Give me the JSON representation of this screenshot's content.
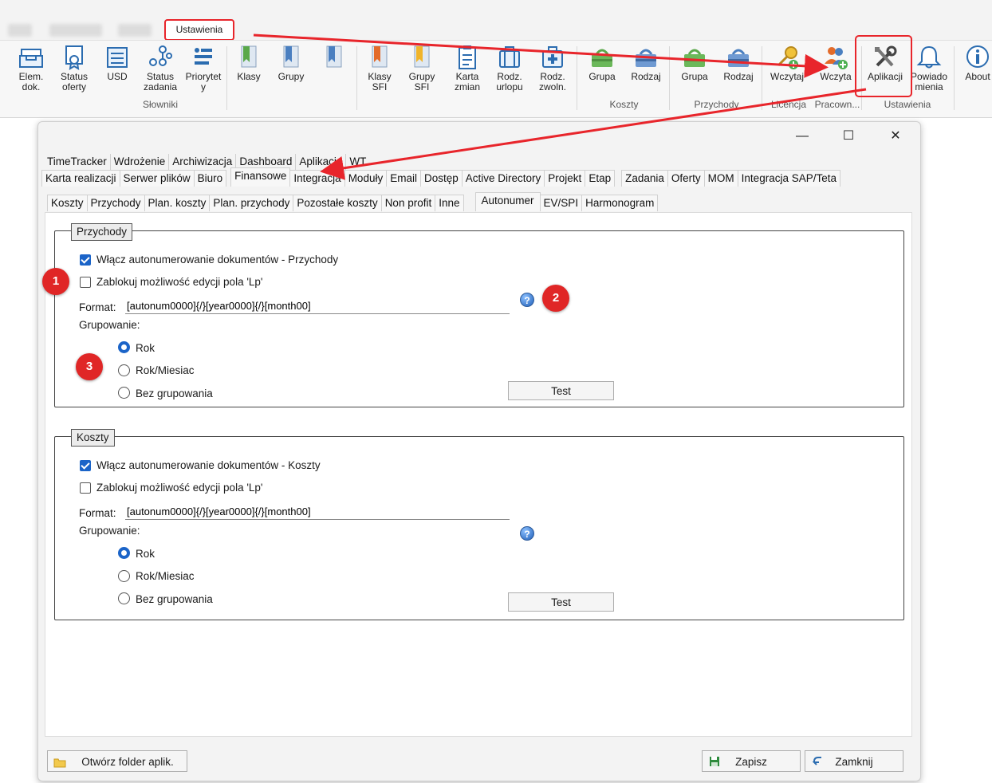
{
  "top_tabs": {
    "settings": "Ustawienia"
  },
  "ribbon": {
    "items": [
      {
        "label": "Elem.\ndok.",
        "icon": "tray-icon"
      },
      {
        "label": "Status\noferty",
        "icon": "certificate-icon"
      },
      {
        "label": "USD",
        "icon": "money-icon"
      },
      {
        "label": "Status\nzadania",
        "icon": "network-icon"
      },
      {
        "label": "Priorytet\ny",
        "icon": "priority-list-icon"
      },
      {
        "label": "Klasy",
        "icon": "bookmark-green-icon"
      },
      {
        "label": "Grupy",
        "icon": "bookmark-blue-icon"
      },
      {
        "label": "",
        "icon": "bookmark-blue-icon"
      },
      {
        "label": "Klasy\nSFI",
        "icon": "bookmark-orange-icon"
      },
      {
        "label": "Grupy\nSFI",
        "icon": "bookmark-yellow-icon"
      },
      {
        "label": "Karta\nzmian",
        "icon": "clipboard-icon"
      },
      {
        "label": "Rodz.\nurlopu",
        "icon": "suitcase-icon"
      },
      {
        "label": "Rodz.\nzwoln.",
        "icon": "medical-bag-icon"
      },
      {
        "label": "Grupa",
        "icon": "basket-green-icon"
      },
      {
        "label": "Rodzaj",
        "icon": "basket-blue-icon"
      },
      {
        "label": "Grupa",
        "icon": "basket-green-icon"
      },
      {
        "label": "Rodzaj",
        "icon": "basket-blue-icon"
      },
      {
        "label": "Wczytaj",
        "icon": "key-add-icon"
      },
      {
        "label": "Wczyta",
        "icon": "users-add-icon"
      },
      {
        "label": "Aplikacji",
        "icon": "tools-icon"
      },
      {
        "label": "Powiado\nmienia",
        "icon": "bell-icon"
      },
      {
        "label": "About",
        "icon": "info-icon"
      }
    ],
    "groups": [
      "Słowniki",
      "Koszty",
      "Przychody",
      "Licencja",
      "Pracown...",
      "Ustawienia"
    ]
  },
  "dialog": {
    "tabs_row1": [
      "TimeTracker",
      "Wdrożenie",
      "Archiwizacja",
      "Dashboard",
      "Aplikacja",
      "WT"
    ],
    "tabs_row2": [
      "Karta realizacji",
      "Serwer plików",
      "Biuro",
      "Finansowe",
      "Integracja",
      "Moduły",
      "Email",
      "Dostęp",
      "Active Directory",
      "Projekt",
      "Etap",
      "Zadania",
      "Oferty",
      "MOM",
      "Integracja SAP/Teta"
    ],
    "tabs_row3": [
      "Koszty",
      "Przychody",
      "Plan. koszty",
      "Plan. przychody",
      "Pozostałe koszty",
      "Non profit",
      "Inne",
      "Autonumer",
      "EV/SPI",
      "Harmonogram"
    ],
    "income": {
      "title": "Przychody",
      "enable_label": "Włącz autonumerowanie dokumentów - Przychody",
      "enable_checked": true,
      "lock_label": "Zablokuj możliwość edycji pola 'Lp'",
      "lock_checked": false,
      "format_label": "Format:",
      "format_value": "[autonum0000]{/}[year0000]{/}[month00]",
      "grouping_label": "Grupowanie:",
      "options": [
        "Rok",
        "Rok/Miesiac",
        "Bez grupowania"
      ],
      "selected": "Rok",
      "test_button": "Test"
    },
    "costs": {
      "title": "Koszty",
      "enable_label": "Włącz autonumerowanie dokumentów - Koszty",
      "enable_checked": true,
      "lock_label": "Zablokuj możliwość edycji pola 'Lp'",
      "lock_checked": false,
      "format_label": "Format:",
      "format_value": "[autonum0000]{/}[year0000]{/}[month00]",
      "grouping_label": "Grupowanie:",
      "options": [
        "Rok",
        "Rok/Miesiac",
        "Bez grupowania"
      ],
      "selected": "Rok",
      "test_button": "Test"
    },
    "footer": {
      "open_folder": "Otwórz folder aplik.",
      "save": "Zapisz",
      "close": "Zamknij"
    },
    "help_glyph": "?"
  },
  "markers": [
    "1",
    "2",
    "3"
  ],
  "colors": {
    "highlight": "#f6f600",
    "annotation": "#e8252b",
    "accent": "#1b64c8"
  }
}
